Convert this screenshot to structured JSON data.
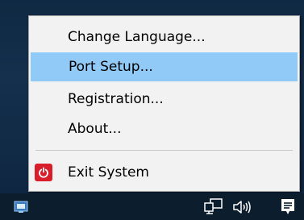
{
  "menu": {
    "items": [
      {
        "label": "Change Language...",
        "highlighted": false
      },
      {
        "label": "Port Setup...",
        "highlighted": true
      },
      {
        "label": "Registration...",
        "highlighted": false
      },
      {
        "label": "About...",
        "highlighted": false
      },
      {
        "label": "Exit System",
        "highlighted": false,
        "icon": "power-icon"
      }
    ],
    "highlight_color": "#91c9f7",
    "exit_icon_color": "#d81e2a"
  },
  "taskbar": {
    "tray_icons": [
      "app-tray-icon",
      "network-icon",
      "volume-icon",
      "notification-icon"
    ]
  }
}
